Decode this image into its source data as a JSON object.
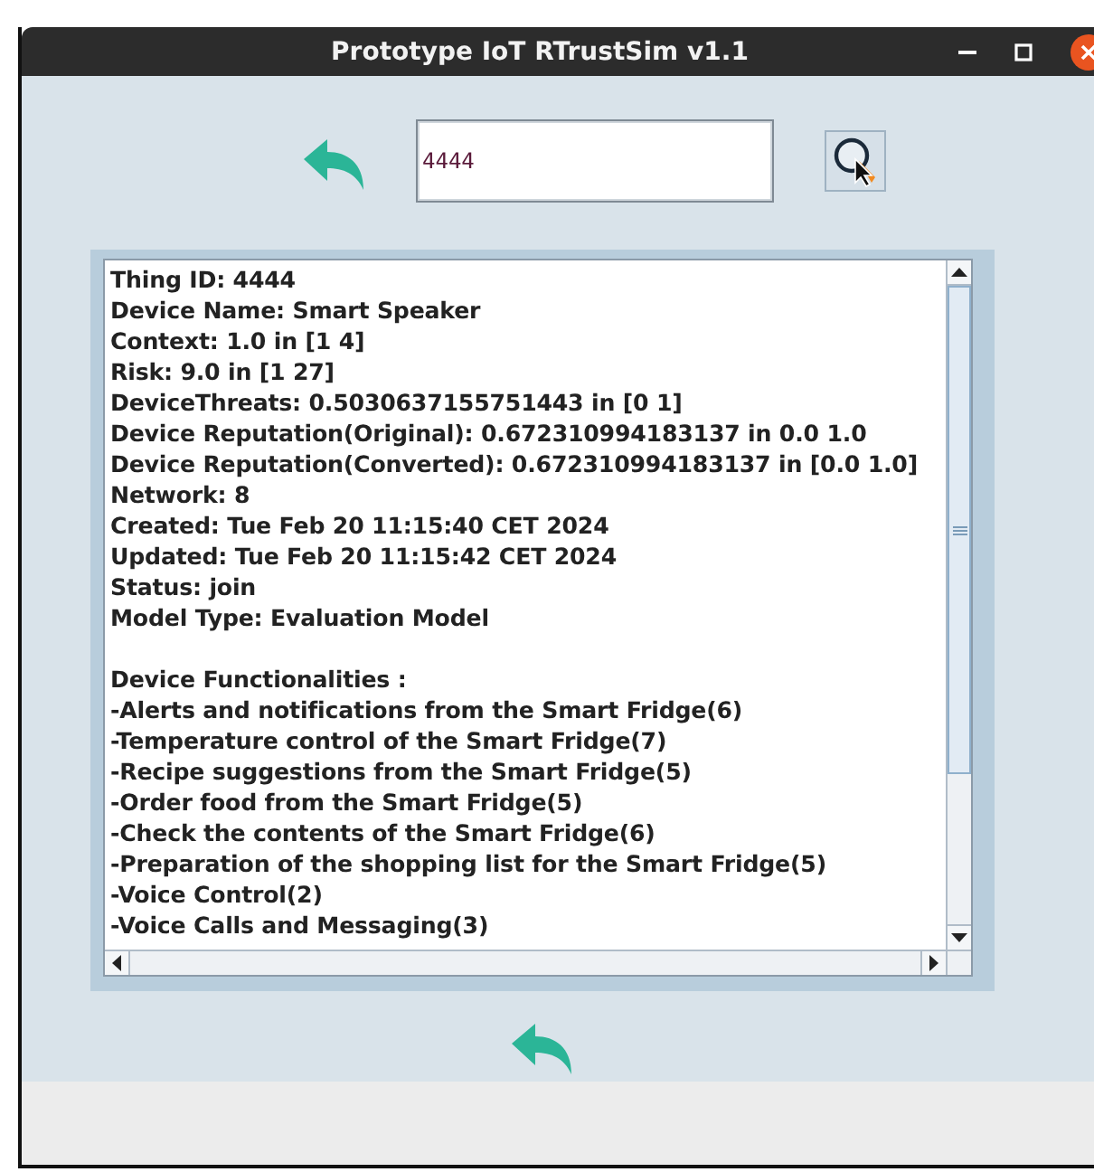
{
  "window": {
    "title": "Prototype IoT RTrustSim v1.1"
  },
  "search": {
    "value": "4444"
  },
  "details": [
    "Thing ID: 4444",
    "Device Name: Smart Speaker",
    "Context: 1.0 in [1 4]",
    "Risk: 9.0 in [1 27]",
    "DeviceThreats: 0.5030637155751443 in [0 1]",
    "Device Reputation(Original): 0.672310994183137 in 0.0 1.0",
    "Device Reputation(Converted): 0.672310994183137 in [0.0 1.0]",
    "Network: 8",
    "Created: Tue Feb 20 11:15:40 CET 2024",
    "Updated: Tue Feb 20 11:15:42 CET 2024",
    "Status: join",
    "Model Type: Evaluation Model"
  ],
  "functionalities": {
    "heading": "Device Functionalities :",
    "items": [
      "-Alerts and notifications from the Smart Fridge(6)",
      "-Temperature control of the Smart Fridge(7)",
      "-Recipe suggestions from the Smart Fridge(5)",
      "-Order food from the Smart Fridge(5)",
      "-Check the contents of the Smart Fridge(6)",
      "-Preparation of the shopping list for the Smart Fridge(5)",
      "-Voice Control(2)",
      "-Voice Calls and Messaging(3)"
    ]
  }
}
